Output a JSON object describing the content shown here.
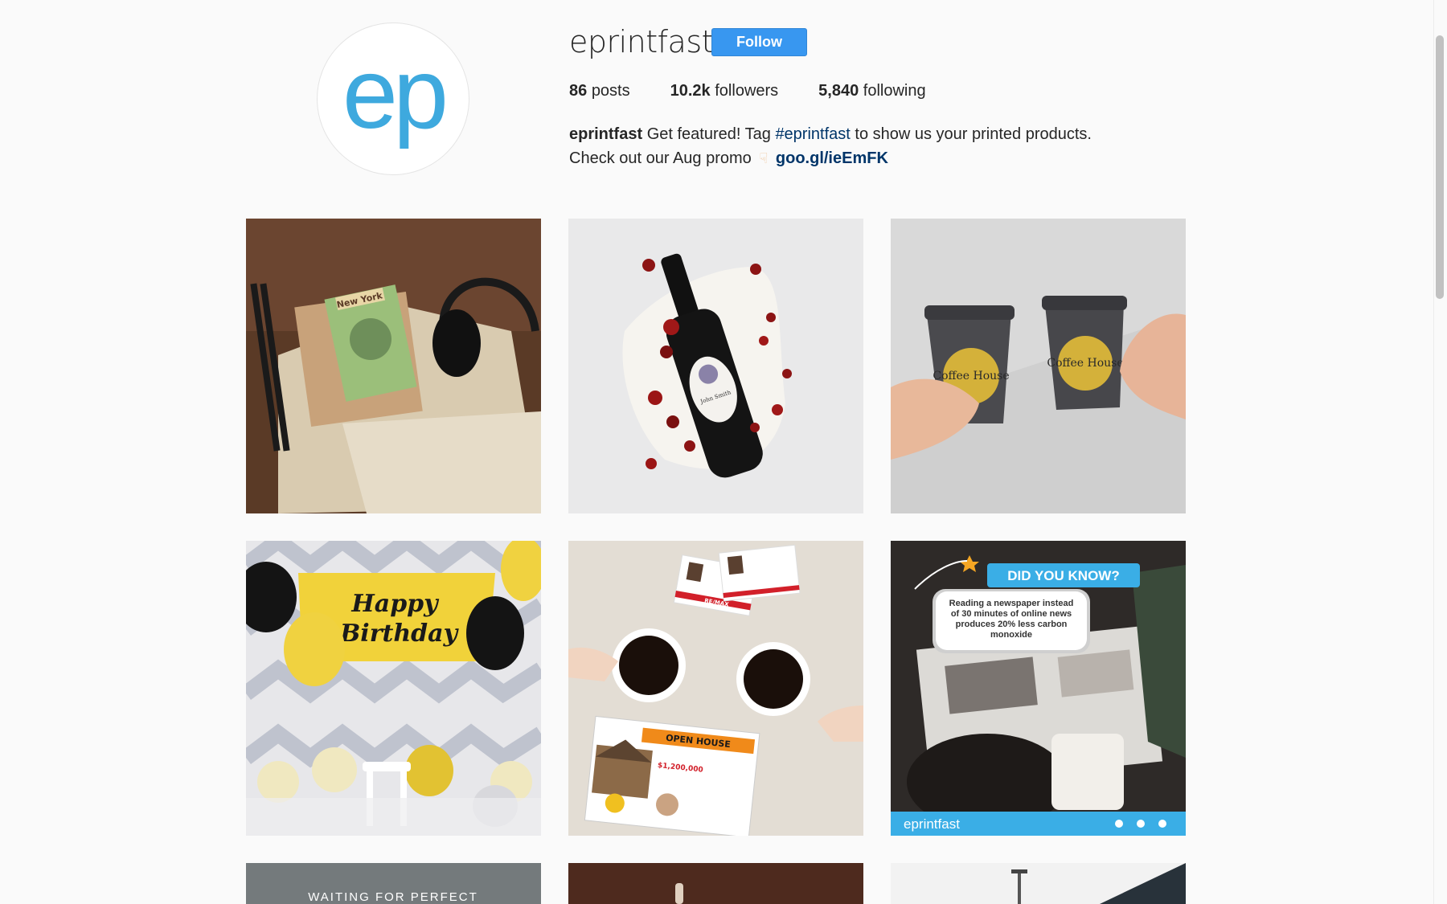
{
  "profile": {
    "avatar_text": "ep",
    "username": "eprintfast",
    "follow_label": "Follow",
    "stats": [
      {
        "count": "86",
        "label": "posts"
      },
      {
        "count": "10.2k",
        "label": "followers"
      },
      {
        "count": "5,840",
        "label": "following"
      }
    ],
    "bio": {
      "name": "eprintfast",
      "text_before_tag": "Get featured! Tag",
      "hashtag": "#eprintfast",
      "text_after_tag": "to show us your printed products.",
      "line2": "Check out our Aug promo",
      "pointer_icon": "backhand-index-pointing-down",
      "promo_link": "goo.gl/ieEmFK"
    }
  },
  "posts": [
    {
      "id": "p1",
      "label": "New York"
    },
    {
      "id": "p2",
      "label": "John Smith"
    },
    {
      "id": "p3",
      "label": "Coffee House",
      "label2": "Coffee House"
    },
    {
      "id": "p4",
      "label": "Happy",
      "label2": "Birthday"
    },
    {
      "id": "p5",
      "label": "OPEN HOUSE",
      "label2": "$1,200,000",
      "brand": "RE/MAX"
    },
    {
      "id": "p6",
      "heading": "DID YOU KNOW?",
      "line1": "Reading a newspaper instead",
      "line2": "of 30 minutes of online news",
      "line3": "produces 20% less carbon",
      "line4": "monoxide",
      "footer": "eprintfast"
    },
    {
      "id": "p7",
      "label": "WAITING FOR PERFECT"
    },
    {
      "id": "p8"
    },
    {
      "id": "p9"
    }
  ],
  "colors": {
    "accent": "#3897f0",
    "link": "#003569",
    "avatar_blue": "#3ea9de"
  }
}
